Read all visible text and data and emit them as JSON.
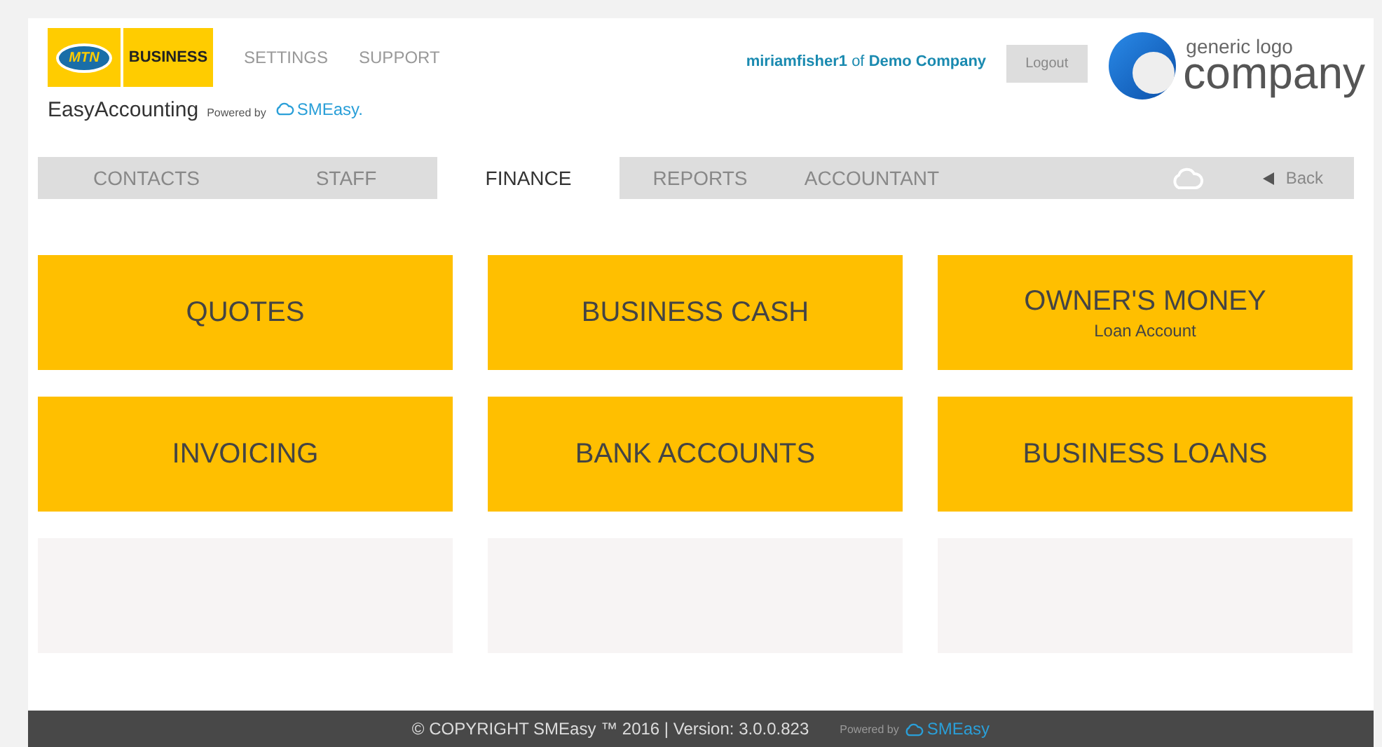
{
  "header": {
    "brand_logo": {
      "left": "MTN",
      "right": "BUSINESS"
    },
    "top_links": [
      "SETTINGS",
      "SUPPORT"
    ],
    "app_name": "EasyAccounting",
    "powered_by": {
      "label": "Powered by",
      "brand": "SMEasy."
    },
    "user": {
      "name": "miriamfisher1",
      "joiner": "of",
      "company": "Demo Company"
    },
    "logout_button": "Logout",
    "company_logo": {
      "small": "generic logo",
      "big": "company"
    }
  },
  "nav": {
    "tabs": [
      {
        "label": "CONTACTS",
        "selected": false
      },
      {
        "label": "STAFF",
        "selected": false
      },
      {
        "label": "FINANCE",
        "selected": true
      },
      {
        "label": "REPORTS",
        "selected": false
      },
      {
        "label": "ACCOUNTANT",
        "selected": false
      }
    ],
    "back": "Back"
  },
  "tiles": [
    {
      "kind": "action",
      "label": "QUOTES"
    },
    {
      "kind": "action",
      "label": "BUSINESS CASH"
    },
    {
      "kind": "action",
      "label": "OWNER'S MONEY",
      "sublabel": "Loan Account"
    },
    {
      "kind": "action",
      "label": "INVOICING"
    },
    {
      "kind": "action",
      "label": "BANK ACCOUNTS"
    },
    {
      "kind": "action",
      "label": "BUSINESS LOANS"
    },
    {
      "kind": "empty"
    },
    {
      "kind": "empty"
    },
    {
      "kind": "empty"
    }
  ],
  "footer": {
    "copyright": "© COPYRIGHT SMEasy ™ 2016 | Version: 3.0.0.823",
    "powered_by": "Powered by",
    "brand": "SMEasy"
  }
}
